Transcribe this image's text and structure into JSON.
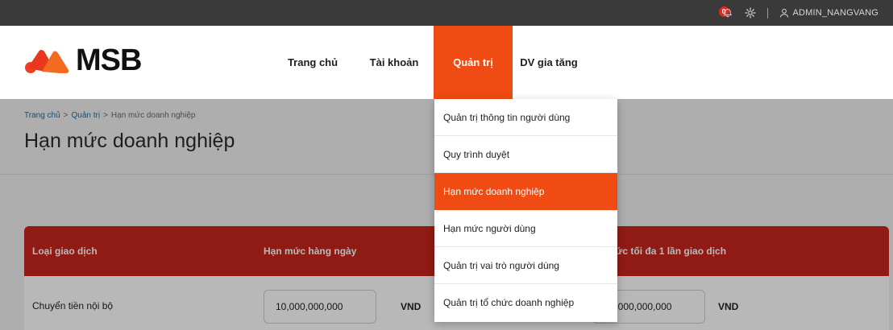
{
  "topbar": {
    "notification_count": "0",
    "user_name": "ADMIN_NANGVANG"
  },
  "brand": {
    "name": "MSB",
    "accent": "#ef4b12"
  },
  "nav": {
    "items": [
      {
        "label": "Trang chủ"
      },
      {
        "label": "Tài khoản"
      },
      {
        "label": "Quản trị"
      },
      {
        "label": "DV gia tăng"
      }
    ],
    "active_index": 2
  },
  "breadcrumb": {
    "home": "Trang chủ",
    "section": "Quản trị",
    "current": "Hạn mức doanh nghiệp",
    "separator": ">"
  },
  "page": {
    "title": "Hạn mức doanh nghiệp"
  },
  "dropdown": {
    "items": [
      {
        "label": "Quản trị thông tin người dùng"
      },
      {
        "label": "Quy trình duyệt"
      },
      {
        "label": "Hạn mức doanh nghiệp"
      },
      {
        "label": "Hạn mức người dùng"
      },
      {
        "label": "Quản trị vai trò người dùng"
      },
      {
        "label": "Quản trị tổ chức doanh nghiệp"
      }
    ],
    "active_index": 2
  },
  "table": {
    "headers": {
      "transaction_type": "Loại giao dịch",
      "daily_limit": "Hạn mức hàng ngày",
      "max_per_transaction": "Hạn mức tối đa 1 lần giao dịch"
    },
    "header_color": "#c8261d",
    "rows": [
      {
        "type": "Chuyển tiền nội bộ",
        "daily_limit": "10,000,000,000",
        "daily_unit": "VND",
        "max_per_tx": "10,000,000,000",
        "max_unit": "VND"
      }
    ]
  }
}
